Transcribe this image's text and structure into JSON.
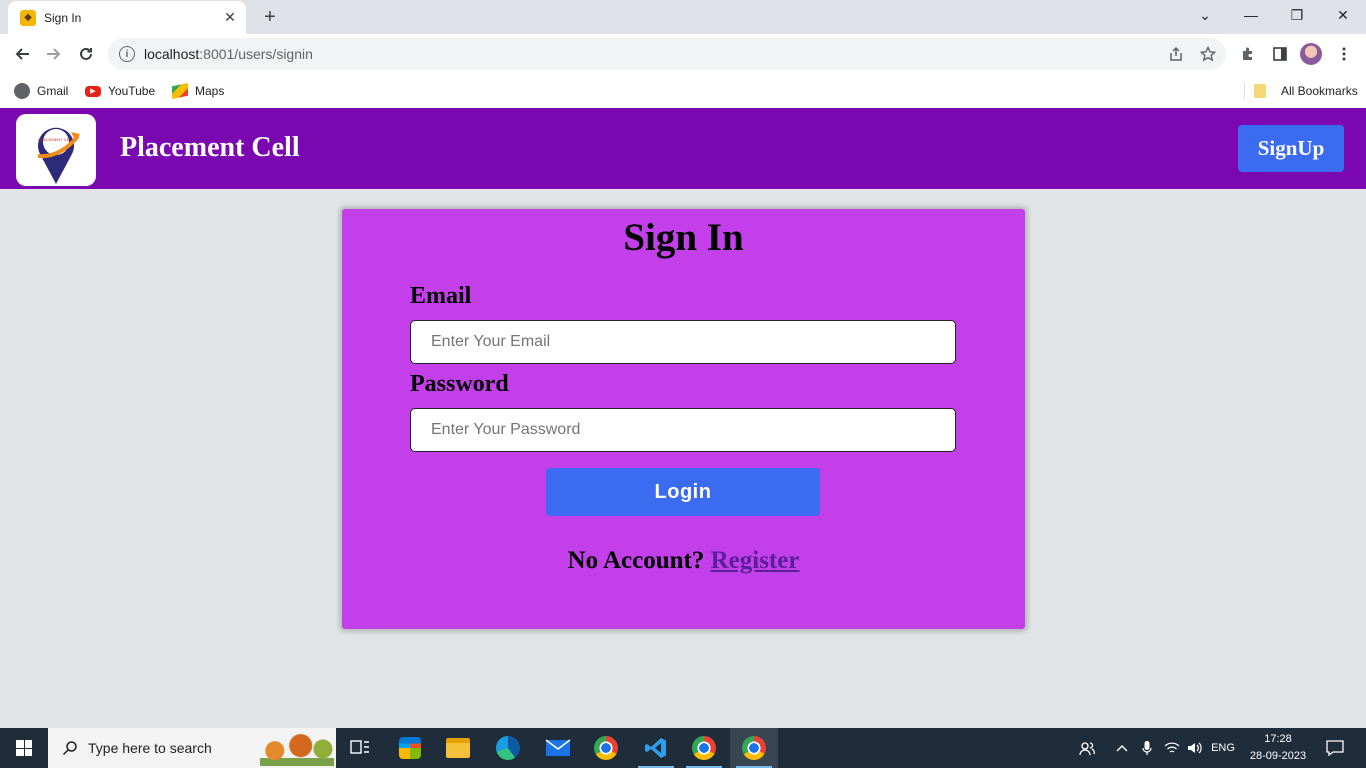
{
  "browser": {
    "tab": {
      "title": "Sign In",
      "close_glyph": "✕"
    },
    "new_tab_glyph": "+",
    "window_controls": {
      "minimize": "—",
      "maximize": "❐",
      "close": "✕",
      "tab_search": "⌄"
    },
    "address": {
      "host": "localhost",
      "rest": ":8001/users/signin"
    },
    "bookmarks": [
      {
        "label": "Gmail",
        "icon": "globe-icon"
      },
      {
        "label": "YouTube",
        "icon": "youtube-icon"
      },
      {
        "label": "Maps",
        "icon": "maps-icon"
      }
    ],
    "all_bookmarks": "All Bookmarks"
  },
  "header": {
    "brand": "Placement Cell",
    "logo_text": "PLACEMENT CELL",
    "signup_label": "SignUp",
    "bg_color": "#7b07b0"
  },
  "signin": {
    "title": "Sign In",
    "email_label": "Email",
    "email_placeholder": "Enter Your Email",
    "password_label": "Password",
    "password_placeholder": "Enter Your Password",
    "login_label": "Login",
    "no_account_text": "No Account?",
    "register_label": "Register",
    "card_color": "#c33fea",
    "button_color": "#3b6bf0"
  },
  "taskbar": {
    "search_placeholder": "Type here to search",
    "language": "ENG",
    "time": "17:28",
    "date": "28-09-2023"
  }
}
